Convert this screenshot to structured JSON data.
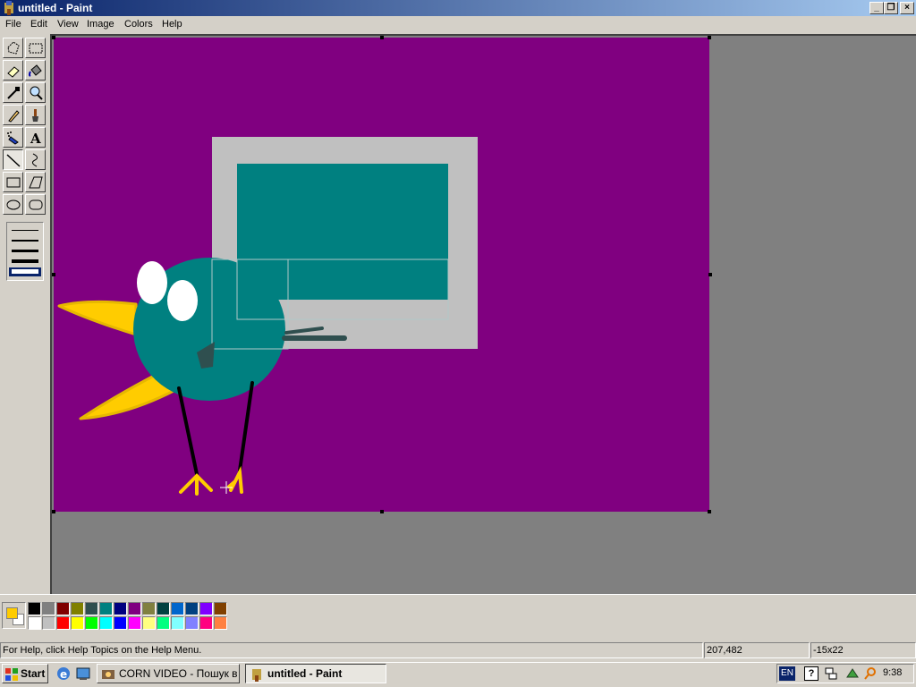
{
  "window": {
    "title": "untitled - Paint",
    "app_icon": "paint-brush-icon",
    "minimize_label": "_",
    "restore_label": "❐",
    "close_label": "×"
  },
  "menu": [
    "File",
    "Edit",
    "View",
    "Image",
    "Colors",
    "Help"
  ],
  "toolbox": {
    "tools": [
      {
        "name": "free-form-select",
        "icon": "free-select-icon"
      },
      {
        "name": "select",
        "icon": "rect-select-icon"
      },
      {
        "name": "eraser",
        "icon": "eraser-icon"
      },
      {
        "name": "fill",
        "icon": "fill-bucket-icon"
      },
      {
        "name": "pick-color",
        "icon": "eyedropper-icon"
      },
      {
        "name": "magnifier",
        "icon": "magnifier-icon"
      },
      {
        "name": "pencil",
        "icon": "pencil-icon"
      },
      {
        "name": "brush",
        "icon": "brush-icon"
      },
      {
        "name": "airbrush",
        "icon": "airbrush-icon"
      },
      {
        "name": "text",
        "icon": "text-icon",
        "glyph": "A"
      },
      {
        "name": "line",
        "icon": "line-icon",
        "selected": true
      },
      {
        "name": "curve",
        "icon": "curve-icon"
      },
      {
        "name": "rectangle",
        "icon": "rectangle-icon"
      },
      {
        "name": "polygon",
        "icon": "polygon-icon"
      },
      {
        "name": "ellipse",
        "icon": "ellipse-icon"
      },
      {
        "name": "rounded-rectangle",
        "icon": "rounded-rect-icon"
      }
    ],
    "line_widths": [
      1,
      2,
      3,
      4,
      5
    ],
    "selected_line_width": 5
  },
  "canvas": {
    "background": "#800080",
    "colors": {
      "monitor_frame": "#c0c0c0",
      "monitor_screen": "#008080",
      "bird_body": "#008080",
      "beak_wing": "#ffcc00",
      "eye": "#ffffff",
      "legs": "#000000",
      "dark_strokes": "#2f4f4f"
    }
  },
  "palette": {
    "foreground": "#ffcc00",
    "background": "#ffffff",
    "row1": [
      "#000000",
      "#808080",
      "#800000",
      "#808000",
      "#2f4f4f",
      "#008080",
      "#000080",
      "#800080",
      "#808040",
      "#004040",
      "#0066cc",
      "#004080",
      "#8000ff",
      "#804000"
    ],
    "row2": [
      "#ffffff",
      "#c0c0c0",
      "#ff0000",
      "#ffff00",
      "#00ff00",
      "#00ffff",
      "#0000ff",
      "#ff00ff",
      "#ffff80",
      "#00ff80",
      "#80ffff",
      "#8080ff",
      "#ff0080",
      "#ff8040"
    ]
  },
  "status": {
    "help_text": "For Help, click Help Topics on the Help Menu.",
    "coordinates": "207,482",
    "size": "-15x22"
  },
  "taskbar": {
    "start_label": "Start",
    "quicklaunch": [
      "ie-icon",
      "show-desktop-icon"
    ],
    "tasks": [
      {
        "label": "CORN VIDEO - Пошук в ...",
        "icon": "browser-icon",
        "active": false
      },
      {
        "label": "untitled - Paint",
        "icon": "paint-brush-icon",
        "active": true
      }
    ],
    "tray": {
      "language": "EN",
      "icons": [
        "help-icon",
        "network-icon",
        "tray-app-icon",
        "search-icon"
      ],
      "time": "9:38"
    }
  }
}
